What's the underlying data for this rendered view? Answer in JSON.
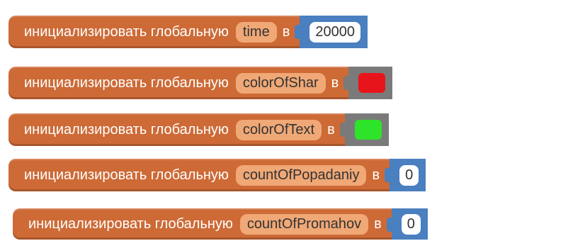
{
  "colors": {
    "block": "#cd6a36",
    "variable_field": "#f0a876",
    "math_socket": "#4a7fc0",
    "color_socket": "#7a7a7a"
  },
  "blocks": [
    {
      "label": "инициализировать глобальную",
      "variable": "time",
      "in_label": "в",
      "value_type": "number",
      "value": "20000"
    },
    {
      "label": "инициализировать глобальную",
      "variable": "colorOfShar",
      "in_label": "в",
      "value_type": "color",
      "value_color": "#e8141b"
    },
    {
      "label": "инициализировать глобальную",
      "variable": "colorOfText",
      "in_label": "в",
      "value_type": "color",
      "value_color": "#2ee42a"
    },
    {
      "label": "инициализировать глобальную",
      "variable": "countOfPopadaniy",
      "in_label": "в",
      "value_type": "number",
      "value": "0"
    },
    {
      "label": "инициализировать глобальную",
      "variable": "countOfPromahov",
      "in_label": "в",
      "value_type": "number",
      "value": "0"
    }
  ]
}
